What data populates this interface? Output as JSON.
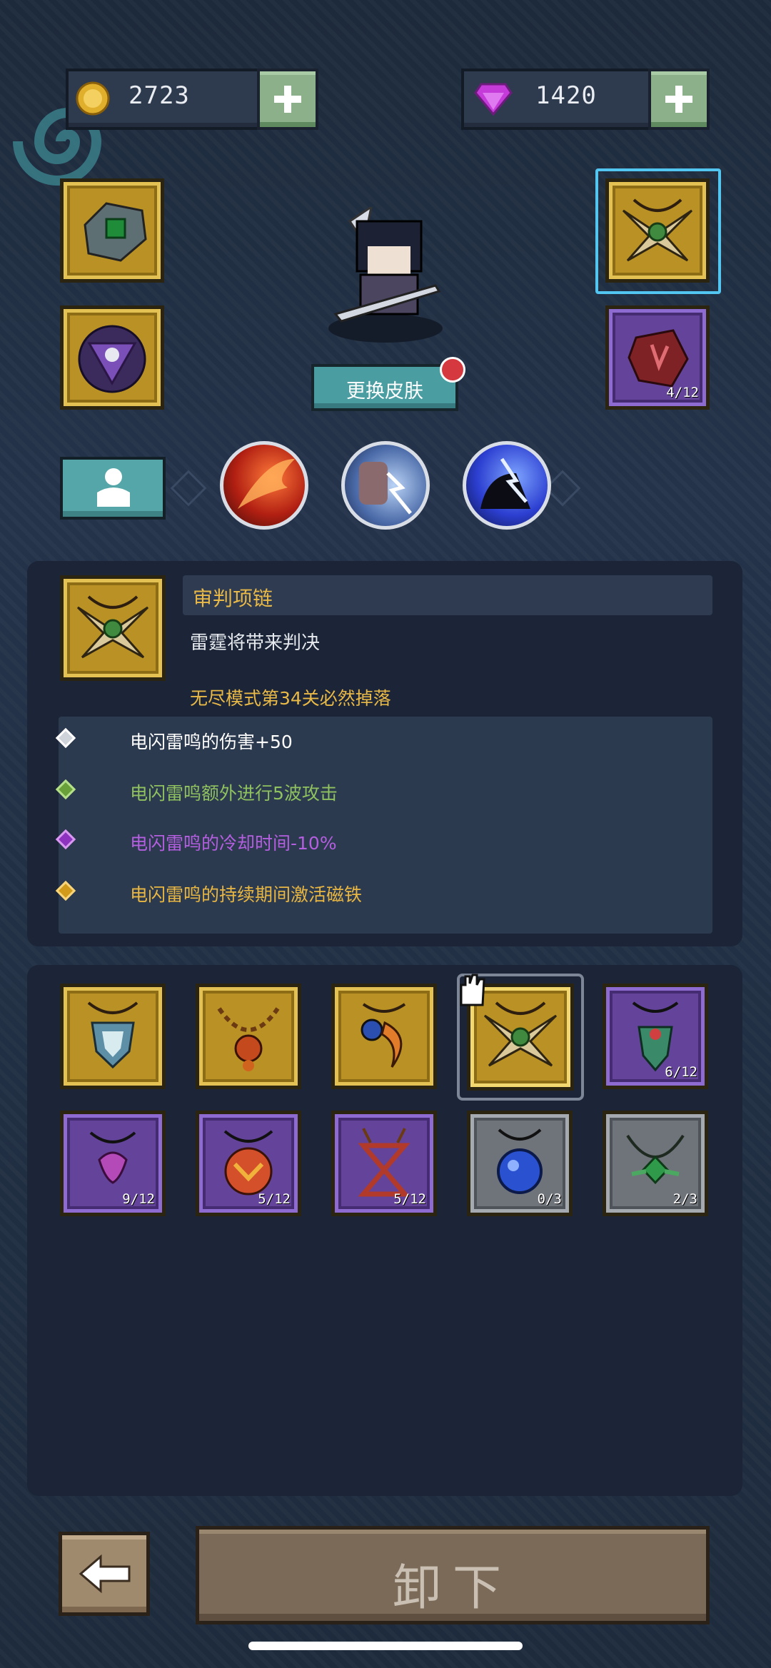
{
  "currency": {
    "gold": "2723",
    "gems": "1420"
  },
  "hero": {
    "change_skin_label": "更换皮肤"
  },
  "equipped": {
    "left": [
      {
        "name": "emerald-armor",
        "tier": "gold"
      },
      {
        "name": "triangle-amulet",
        "tier": "gold"
      }
    ],
    "right": [
      {
        "name": "judgment-necklace",
        "tier": "gold",
        "selected": true
      },
      {
        "name": "ruby-crystal",
        "tier": "purple",
        "count": "4/12"
      }
    ]
  },
  "skills": [
    "fire-slash-icon",
    "lightning-fist-icon",
    "lightning-bell-icon"
  ],
  "item_detail": {
    "name": "审判项链",
    "description": "雷霆将带来判决",
    "drop_info": "无尽模式第34关必然掉落",
    "stats": [
      {
        "text": "电闪雷鸣的伤害+50",
        "color": "#ffffff"
      },
      {
        "text": "电闪雷鸣额外进行5波攻击",
        "color": "#8fc25f"
      },
      {
        "text": "电闪雷鸣的冷却时间-10%",
        "color": "#b45ee0"
      },
      {
        "text": "电闪雷鸣的持续期间激活磁铁",
        "color": "#e8b642"
      }
    ]
  },
  "inventory": [
    {
      "name": "crest-necklace",
      "tier": "gold",
      "count": ""
    },
    {
      "name": "amber-bead-necklace",
      "tier": "gold",
      "count": ""
    },
    {
      "name": "eye-fang-necklace",
      "tier": "gold",
      "count": ""
    },
    {
      "name": "judgment-necklace",
      "tier": "gold",
      "count": "",
      "selected": true
    },
    {
      "name": "leaf-pendant",
      "tier": "purple",
      "count": "6/12"
    },
    {
      "name": "violet-pendant",
      "tier": "purple",
      "count": "9/12"
    },
    {
      "name": "ruby-amulet",
      "tier": "purple",
      "count": "5/12"
    },
    {
      "name": "hourglass-pendant",
      "tier": "purple",
      "count": "5/12"
    },
    {
      "name": "sapphire-pendant",
      "tier": "grey",
      "count": "0/3"
    },
    {
      "name": "emerald-chain",
      "tier": "grey",
      "count": "2/3"
    }
  ],
  "actions": {
    "unequip_label": "卸下"
  }
}
